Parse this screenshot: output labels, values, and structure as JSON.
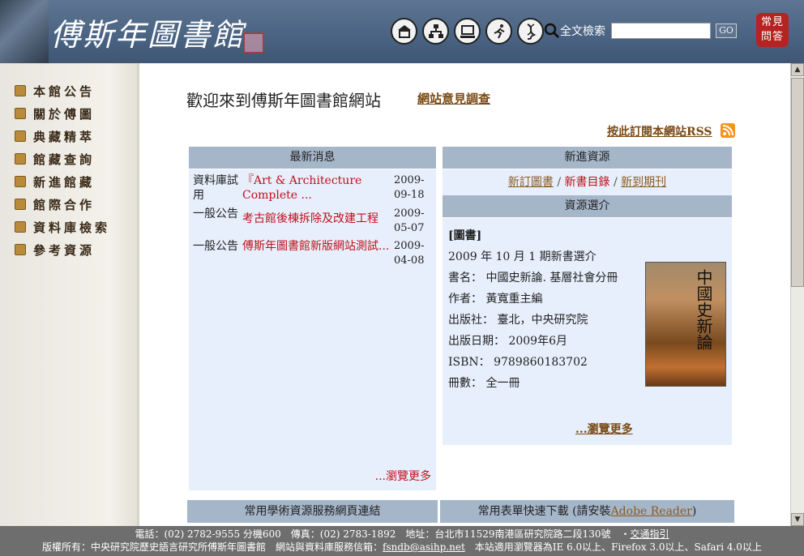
{
  "header": {
    "logo_text": "傅斯年圖書館",
    "search_label": "全文檢索",
    "search_value": "",
    "go_label": "GO",
    "faq_label": "常見問答",
    "icons": [
      "home-icon",
      "sitemap-icon",
      "computer-icon",
      "runner-icon",
      "dna-icon"
    ]
  },
  "sidebar": {
    "items": [
      {
        "label": "本館公告"
      },
      {
        "label": "關於傅圖"
      },
      {
        "label": "典藏精萃"
      },
      {
        "label": "館藏查詢"
      },
      {
        "label": "新進館藏"
      },
      {
        "label": "館際合作"
      },
      {
        "label": "資料庫檢索"
      },
      {
        "label": "參考資源"
      }
    ]
  },
  "main": {
    "welcome": "歡迎來到傅斯年圖書館網站",
    "survey_link": "網站意見調查",
    "rss_link": "按此訂閱本網站RSS",
    "news": {
      "title": "最新消息",
      "rows": [
        {
          "category": "資料庫試用",
          "title": "『Art & Architecture Complete ...",
          "date": "2009-09-18"
        },
        {
          "category": "一般公告",
          "title": "考古館後棟拆除及改建工程",
          "date": "2009-05-07"
        },
        {
          "category": "一般公告",
          "title": "傅斯年圖書館新版網站測試...",
          "date": "2009-04-08"
        }
      ],
      "more": "...瀏覽更多"
    },
    "new_resources": {
      "title": "新進資源",
      "link1": "新訂圖書",
      "link2": "新書目錄",
      "link3": "新到期刊",
      "sep": " / "
    },
    "resource_intro": {
      "title": "資源選介",
      "type": "[圖書]",
      "issue": "2009 年 10 月 1 期新書選介",
      "book_name": "書名： 中國史新論. 基層社會分冊",
      "author": "作者： 黃寬重主編",
      "publisher": "出版社： 臺北，中央研究院",
      "pub_date": "出版日期： 2009年6月",
      "isbn": "ISBN： 9789860183702",
      "volumes": "冊數： 全一冊",
      "cover_text": "中國史新論",
      "more": "...瀏覽更多"
    },
    "links_head": "常用學術資源服務網頁連結",
    "forms_head_prefix": "常用表單快速下載 (請安裝",
    "forms_head_link": "Adobe Reader",
    "forms_head_suffix": ")"
  },
  "footer": {
    "line1": "電話：(02) 2782-9555 分機600　傳真：(02) 2783-1892　地址：台北市11529南港區研究院路二段130號　‧",
    "line1_link": "交通指引",
    "line2_prefix": "版權所有：中央研究院歷史語言研究所傅斯年圖書館　網站與資料庫服務信箱：",
    "line2_email": "fsndb@asihp.net",
    "line2_suffix": "　本站適用瀏覽器為IE 6.0以上、Firefox 3.0以上、Safari 4.0以上"
  }
}
